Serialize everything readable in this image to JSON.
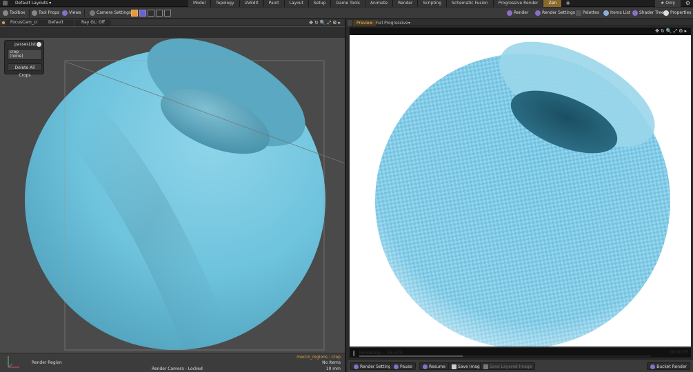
{
  "topbar": {
    "layouts": "Default Layouts ▾",
    "tabs": [
      "Model",
      "Topology",
      "UVEdit",
      "Paint",
      "Layout",
      "Setup",
      "Game Tools",
      "Animate",
      "Render",
      "Scripting",
      "Schematic Fusion",
      "Progressive Render",
      "Zen"
    ],
    "active_tab": "Zen",
    "plus": "+",
    "only": "★ Only",
    "gear": "⚙"
  },
  "toolbar": {
    "toolbox": "Toolbox",
    "tool_props": "Tool Props",
    "views": "Views",
    "camera_settings": "Camera Settings",
    "render": "Render",
    "render_settings": "Render Settings",
    "palettes": "Palettes",
    "items_list": "Items List",
    "shader_tree": "Shader Tree",
    "properties": "Properties"
  },
  "left_viewport": {
    "camera": "FocusCam_cr…",
    "style": "Default",
    "shading": "Ray GL: Off",
    "controls": "✥↻🔍⤢⚙▸",
    "passes": {
      "title": "passesList",
      "field_label": "crop",
      "field_value": "(none)",
      "delete_button": "Delete All Crops"
    },
    "footer": {
      "render_region": "Render Region",
      "status": "Render Camera - Locked",
      "regions": "mecco_regions : crop",
      "items": "No Items",
      "size": "10 mm"
    }
  },
  "right_panel": {
    "tabs": {
      "preview": "Preview",
      "full_progressive": "Full Progressive",
      "dropdown": "▾"
    },
    "controls": "✥↻🔍⤢⚙▸",
    "progress": {
      "text": "Rendering ... 35.57%",
      "value": 0.3557,
      "time": "00:00:05"
    },
    "footer": {
      "render_settings": "Render Settings",
      "pause": "Pause",
      "resume": "Resume",
      "save_image": "Save Image",
      "save_layered": "Save Layered Image",
      "bucket_render": "Bucket Render"
    }
  },
  "colors": {
    "accent": "#e6a43a",
    "sphere": "#6ec3dd",
    "render_bg": "#ffffff"
  }
}
